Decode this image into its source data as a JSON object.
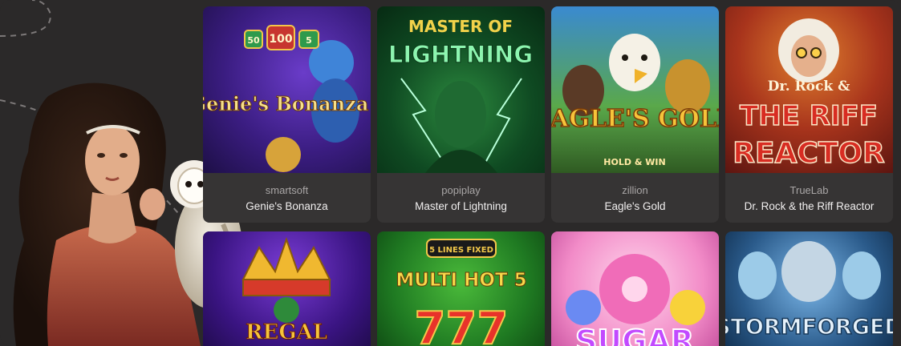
{
  "colors": {
    "background": "#2b2929",
    "card": "#363434",
    "provider_text": "#a9a6a6",
    "title_text": "#f1efef"
  },
  "games": [
    {
      "provider": "smartsoft",
      "title": "Genie's Bonanza",
      "art_text": "Genie's Bonanza",
      "art_badges": [
        "50",
        "100",
        "5"
      ]
    },
    {
      "provider": "popiplay",
      "title": "Master of Lightning",
      "art_text_top": "MASTER OF",
      "art_text_bottom": "LIGHTNING"
    },
    {
      "provider": "zillion",
      "title": "Eagle's Gold",
      "art_text": "EAGLE'S GOLD",
      "art_sub": "HOLD & WIN"
    },
    {
      "provider": "TrueLab",
      "title": "Dr. Rock & the Riff Reactor",
      "art_text_top": "Dr. Rock &",
      "art_text_mid": "THE RIFF",
      "art_text_bottom": "REACTOR"
    }
  ],
  "games_row2": [
    {
      "art_text": "REGAL"
    },
    {
      "art_badge": "5 LINES FIXED",
      "art_text": "MULTI HOT 5",
      "art_num": "777"
    },
    {
      "art_text": "SUGAR"
    },
    {
      "art_text": "STORMFORGED"
    }
  ]
}
